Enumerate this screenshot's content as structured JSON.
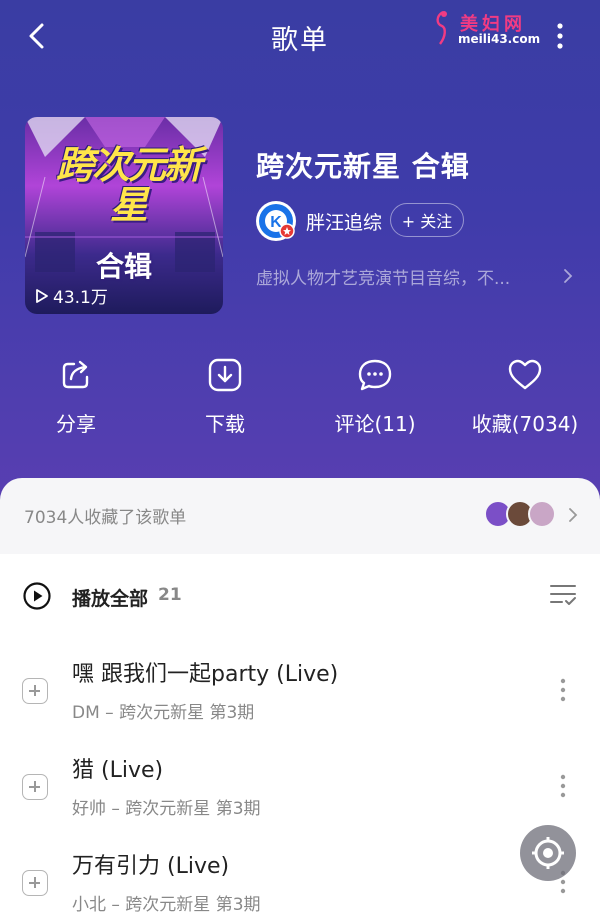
{
  "header": {
    "title": "歌单",
    "watermark_title": "美妇网",
    "watermark_url": "meili43.com"
  },
  "playlist": {
    "name": "跨次元新星 合辑",
    "cover_title": "跨次元新星",
    "cover_subtitle": "合辑",
    "play_count": "43.1万",
    "creator": "胖汪追综",
    "creator_badge": "K",
    "follow_label": "+ 关注",
    "description": "虚拟人物才艺竞演节目音综，不..."
  },
  "actions": [
    {
      "label": "分享",
      "icon": "share-icon"
    },
    {
      "label": "下载",
      "icon": "download-icon"
    },
    {
      "label": "评论(11)",
      "icon": "comment-icon"
    },
    {
      "label": "收藏(7034)",
      "icon": "heart-icon"
    }
  ],
  "collectors": {
    "text": "7034人收藏了该歌单"
  },
  "list": {
    "play_all_label": "播放全部",
    "count": "21",
    "songs": [
      {
        "title": "嘿 跟我们一起party (Live)",
        "subtitle": "DM – 跨次元新星 第3期"
      },
      {
        "title": "猎 (Live)",
        "subtitle": "好帅 – 跨次元新星 第3期"
      },
      {
        "title": "万有引力 (Live)",
        "subtitle": "小北 – 跨次元新星 第3期"
      }
    ]
  },
  "colors": {
    "header_bg": "#3f3caa",
    "accent_pink": "#f13b83",
    "creator_badge": "#1a73e8"
  }
}
